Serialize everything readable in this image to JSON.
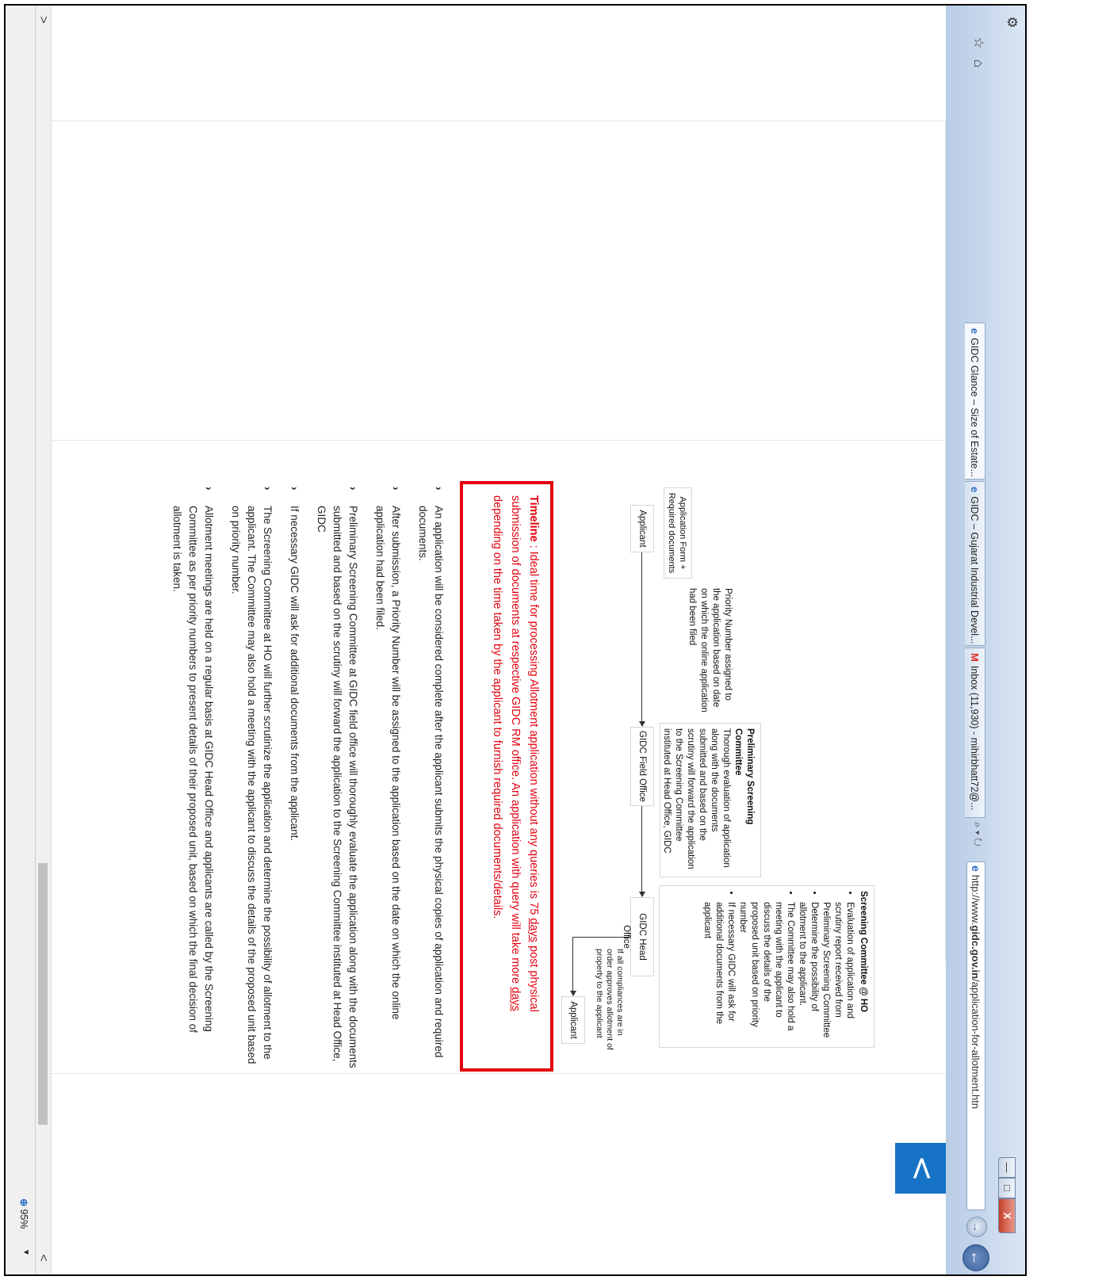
{
  "browser": {
    "url_prefix": "http://www.",
    "url_domain": "gidc.gov.in",
    "url_path": "/application-for-allotment.htn",
    "addr_actions": "⌕ ▾ ↻",
    "tabs": [
      {
        "label": "Inbox (11,930) - mihirbhatt72@...",
        "icon": "gmail-icon"
      },
      {
        "label": "GIDC – Gujarat Industrial Devel...",
        "icon": "ie-icon"
      },
      {
        "label": "GIDC Glance – Size of Estate...",
        "icon": "ie-icon",
        "active": true
      }
    ],
    "close_label": "X",
    "max_label": "□",
    "min_label": "—",
    "tab_close": "×",
    "home_icon": "⌂",
    "star_icon": "☆",
    "gear_icon": "⚙",
    "back_glyph": "←",
    "fwd_glyph": "→",
    "zoom": "95%",
    "zoom_dropdown": "▼",
    "scroll_left": "<",
    "scroll_right": ">"
  },
  "page": {
    "back_button": "<",
    "diagram": {
      "applicant_start": "Applicant",
      "app_form": "Application Form + Required documents",
      "priority_note": "Priority Number assigned to the application based on date on which the online application had been filed",
      "field_office": "GIDC Field Office",
      "psc_title": "Preliminary Screening Committee",
      "psc_body": "Thorough evaluation of application along with the documents submitted and based on the scrutiny will forward the application to the Screening Committee instituted at Head Office, GIDC",
      "head_office": "GIDC Head Office",
      "sc_title": "Screening Committee @ HO",
      "sc_items": [
        "Evaluation of application and scrutiny report received from Preliminary Screening Committee",
        "Determine the possibility of allotment to the applicant.",
        "The Committee may also hold a meeting with the applicant to discuss the details of the proposed unit based on priority number",
        "If necessary GIDC will ask for additional documents from the applicant"
      ],
      "compliance_note": "If all compliances are in order approves allotment of property to the applicant",
      "applicant_end": "Applicant"
    },
    "timeline": {
      "label": "Timeline",
      "sep": " : ",
      "part1": "Ideal time for processing Allotment application without any queries is 75 ",
      "days1": "days",
      "part2": " post physical submission of documents at respective GIDC RM office. An application with query will take more ",
      "days2": "days",
      "part3": " depending on the time taken by the applicant to furnish required documents/details."
    },
    "bullets": [
      "An application will be considered complete after the applicant submits the physical copies of application and required documents.",
      "After submission, a Priority Number will be assigned to the application based on the date on which the online application had been filed.",
      "Preliminary Screening Committee at GIDC field office will thoroughly evaluate the application along with the documents submitted and based on the scrutiny will forward the application to the Screening Committee instituted at Head Office, GIDC",
      "If necessary GIDC will ask for additional documents from the applicant.",
      "The Screening Committee at HO will further scrutinize the application and determine the possibility of allotment to the applicant. The Committee may also hold a meeting with the applicant to discuss the details of the proposed unit based on priority number.",
      "Allotment meetings are held on a regular basis at GIDC Head Office and applicants are called by the Screening Committee as per priority numbers to present details of their proposed unit, based on which the final decision of allotment is taken."
    ],
    "bullet_glyph": "›"
  },
  "colors": {
    "accent_red": "#e3000f",
    "back_button_blue": "#1673c6"
  }
}
